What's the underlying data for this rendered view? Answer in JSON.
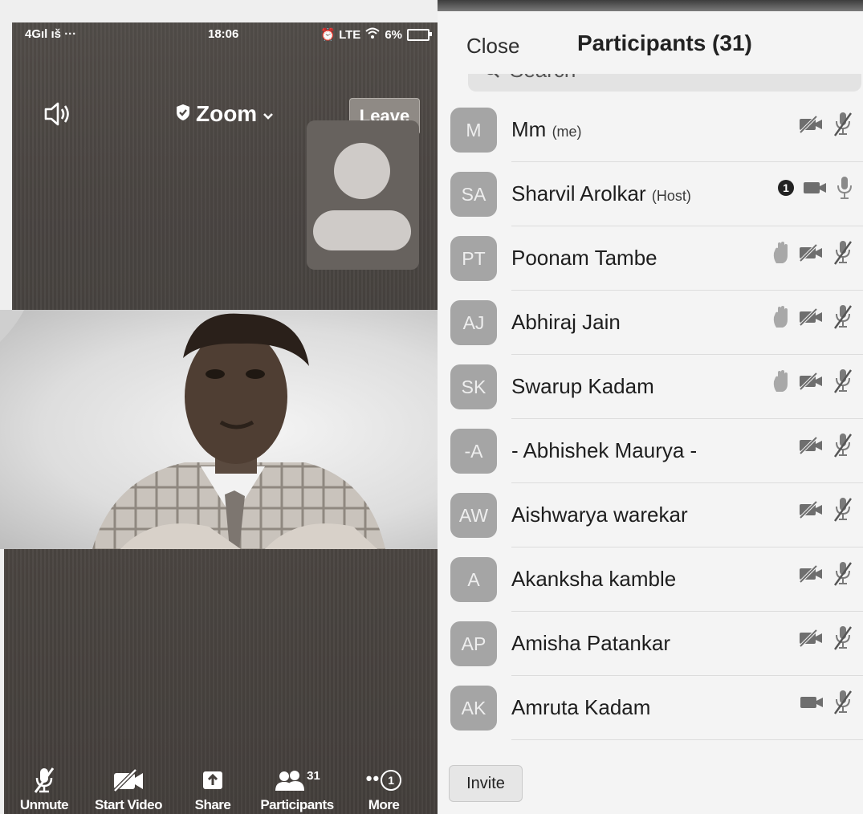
{
  "status_bar": {
    "left": "4Gıl ıš ···",
    "time": "18:06",
    "right": "⏰ LTE",
    "battery": "6%"
  },
  "meeting": {
    "title": "Zoom",
    "leave_label": "Leave"
  },
  "toolbar": {
    "unmute_label": "Unmute",
    "start_video_label": "Start Video",
    "share_label": "Share",
    "participants_label": "Participants",
    "participants_count": "31",
    "more_label": "More",
    "more_badge": "1"
  },
  "panel": {
    "close_label": "Close",
    "title": "Participants (31)",
    "search_placeholder": "Search",
    "invite_label": "Invite"
  },
  "participants": [
    {
      "initials": "M",
      "name": "Mm",
      "role": "(me)",
      "badge": "",
      "hand": false,
      "video_off": true,
      "mic_muted": true
    },
    {
      "initials": "SA",
      "name": "Sharvil Arolkar",
      "role": "(Host)",
      "badge": "1",
      "hand": false,
      "video_off": false,
      "mic_muted": false
    },
    {
      "initials": "PT",
      "name": "Poonam Tambe",
      "role": "",
      "badge": "",
      "hand": true,
      "video_off": true,
      "mic_muted": true
    },
    {
      "initials": "AJ",
      "name": "Abhiraj Jain",
      "role": "",
      "badge": "",
      "hand": true,
      "video_off": true,
      "mic_muted": true
    },
    {
      "initials": "SK",
      "name": "Swarup Kadam",
      "role": "",
      "badge": "",
      "hand": true,
      "video_off": true,
      "mic_muted": true
    },
    {
      "initials": "-A",
      "name": "- Abhishek Maurya -",
      "role": "",
      "badge": "",
      "hand": false,
      "video_off": true,
      "mic_muted": true
    },
    {
      "initials": "AW",
      "name": "Aishwarya warekar",
      "role": "",
      "badge": "",
      "hand": false,
      "video_off": true,
      "mic_muted": true
    },
    {
      "initials": "A",
      "name": "Akanksha  kamble",
      "role": "",
      "badge": "",
      "hand": false,
      "video_off": true,
      "mic_muted": true
    },
    {
      "initials": "AP",
      "name": "Amisha Patankar",
      "role": "",
      "badge": "",
      "hand": false,
      "video_off": true,
      "mic_muted": true
    },
    {
      "initials": "AK",
      "name": "Amruta Kadam",
      "role": "",
      "badge": "",
      "hand": false,
      "video_off": false,
      "mic_muted": true
    }
  ]
}
